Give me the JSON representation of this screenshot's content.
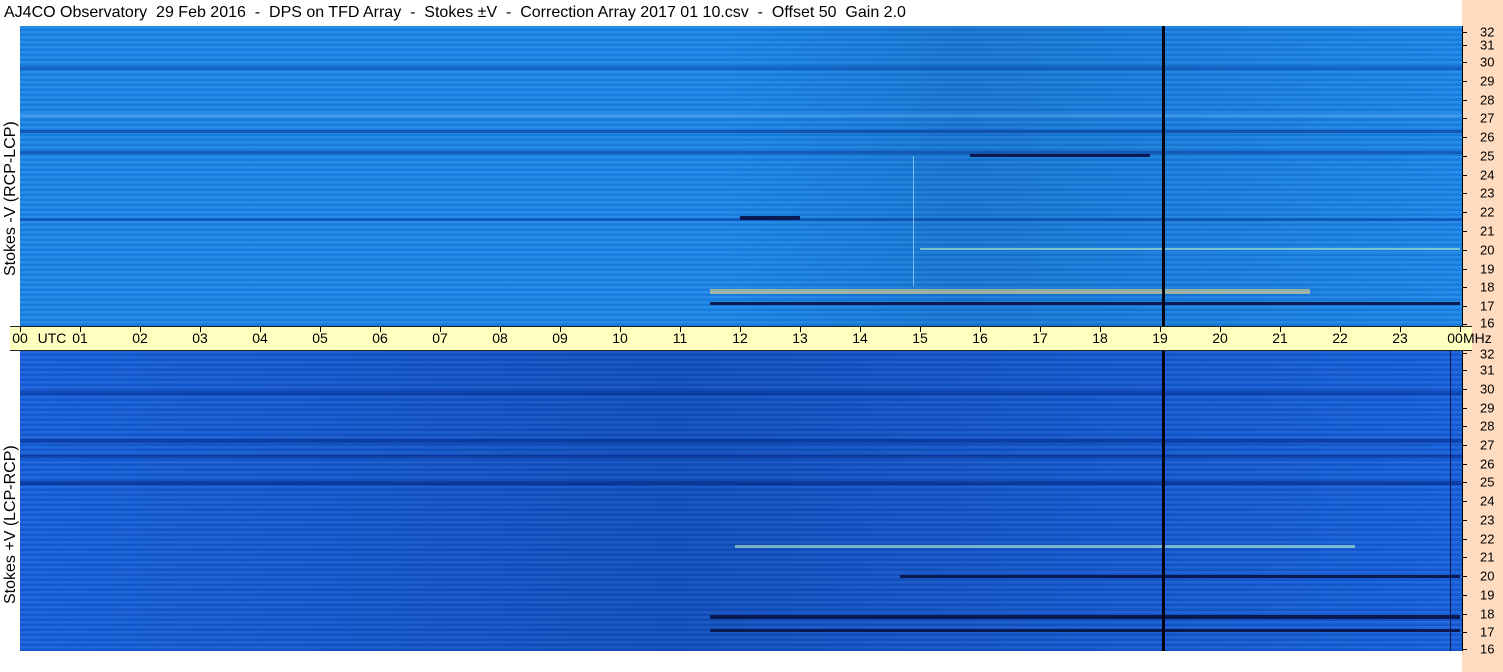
{
  "title": "AJ4CO Observatory  29 Feb 2016  -  DPS on TFD Array  -  Stokes ±V  -  Correction Array 2017 01 10.csv  -  Offset 50  Gain 2.0",
  "panels": {
    "top_label": "Stokes -V (RCP-LCP)",
    "bottom_label": "Stokes +V (LCP-RCP)"
  },
  "time_axis": {
    "start_label": "00",
    "utc_label": "UTC",
    "hours": [
      "01",
      "02",
      "03",
      "04",
      "05",
      "06",
      "07",
      "08",
      "09",
      "10",
      "11",
      "12",
      "13",
      "14",
      "15",
      "16",
      "17",
      "18",
      "19",
      "20",
      "21",
      "22",
      "23"
    ],
    "end_label": "00",
    "unit_label": "MHz"
  },
  "freq_axis": {
    "labels": [
      "32",
      "31",
      "30",
      "29",
      "28",
      "27",
      "26",
      "25",
      "24",
      "23",
      "22",
      "21",
      "20",
      "19",
      "18",
      "17",
      "16"
    ]
  },
  "colors": {
    "top_base": "#1a86e8",
    "bottom_base": "#1661dd",
    "axis_bg": "#ffffc0",
    "right_strip": "#ffdcc0",
    "marker": "#050510"
  }
}
